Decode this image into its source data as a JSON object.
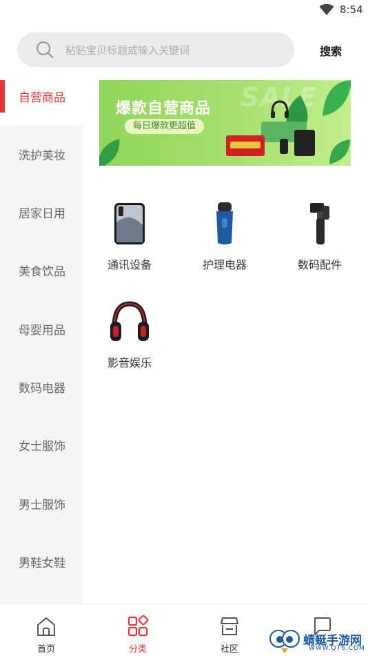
{
  "status_bar": {
    "time": "8:54",
    "wifi_icon": "wifi-icon"
  },
  "search": {
    "placeholder": "粘贴宝贝标题或输入关键词",
    "button_label": "搜索"
  },
  "sidebar": {
    "items": [
      {
        "label": "自营商品",
        "active": true
      },
      {
        "label": "洗护美妆"
      },
      {
        "label": "居家日用"
      },
      {
        "label": "美食饮品"
      },
      {
        "label": "母婴用品"
      },
      {
        "label": "数码电器"
      },
      {
        "label": "女士服饰"
      },
      {
        "label": "男士服饰"
      },
      {
        "label": "男鞋女鞋"
      }
    ]
  },
  "banner": {
    "title": "爆款自营商品",
    "subtitle": "每日爆款更超值",
    "watermark_text": "SALE"
  },
  "categories": [
    {
      "label": "通讯设备",
      "icon": "smartphone-icon"
    },
    {
      "label": "护理电器",
      "icon": "electric-shaver-icon"
    },
    {
      "label": "数码配件",
      "icon": "gimbal-stabilizer-icon"
    },
    {
      "label": "影音娱乐",
      "icon": "headphones-icon"
    }
  ],
  "tabs": [
    {
      "label": "首页",
      "icon": "home-icon"
    },
    {
      "label": "分类",
      "icon": "category-grid-icon",
      "active": true
    },
    {
      "label": "社区",
      "icon": "community-shop-icon"
    },
    {
      "label": "",
      "icon": "chat-bubble-icon"
    }
  ],
  "watermark": {
    "title": "蜻蜓手游网",
    "subtitle": "WWW.QT6.COM"
  },
  "colors": {
    "accent": "#e8373c",
    "sidebar_bg": "#f5f5f5",
    "search_bg": "#ececec"
  }
}
